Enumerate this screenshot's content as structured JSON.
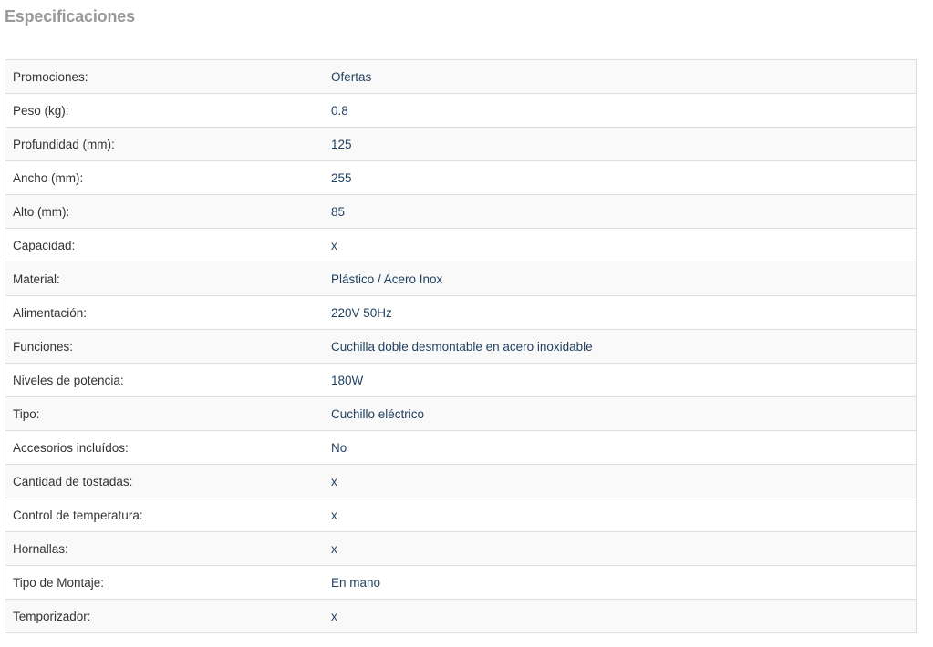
{
  "section": {
    "title": "Especificaciones"
  },
  "specs": [
    {
      "label": "Promociones:",
      "value": "Ofertas"
    },
    {
      "label": "Peso (kg):",
      "value": "0.8"
    },
    {
      "label": "Profundidad (mm):",
      "value": "125"
    },
    {
      "label": "Ancho (mm):",
      "value": "255"
    },
    {
      "label": "Alto (mm):",
      "value": "85"
    },
    {
      "label": "Capacidad:",
      "value": "x"
    },
    {
      "label": "Material:",
      "value": "Plástico / Acero Inox"
    },
    {
      "label": "Alimentación:",
      "value": "220V 50Hz"
    },
    {
      "label": "Funciones:",
      "value": "Cuchilla doble desmontable en acero inoxidable"
    },
    {
      "label": "Niveles de potencia:",
      "value": "180W"
    },
    {
      "label": "Tipo:",
      "value": "Cuchillo eléctrico"
    },
    {
      "label": "Accesorios incluídos:",
      "value": "No"
    },
    {
      "label": "Cantidad de tostadas:",
      "value": "x"
    },
    {
      "label": "Control de temperatura:",
      "value": "x"
    },
    {
      "label": "Hornallas:",
      "value": "x"
    },
    {
      "label": "Tipo de Montaje:",
      "value": "En mano"
    },
    {
      "label": "Temporizador:",
      "value": "x"
    }
  ],
  "colors": {
    "title": "#999999",
    "label_text": "#333333",
    "value_text": "#1f3f5f",
    "row_odd": "#f9f9f9",
    "row_even": "#ffffff",
    "border": "#dddddd"
  }
}
